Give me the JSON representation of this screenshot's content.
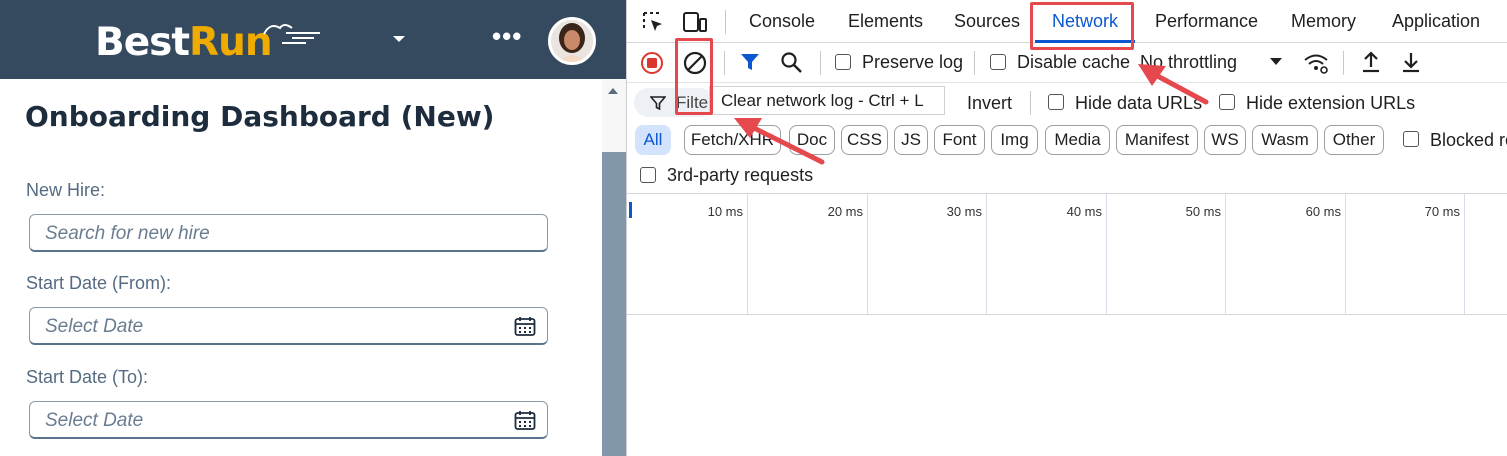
{
  "app": {
    "logo_best": "Best",
    "logo_run": "Run",
    "more_label": "•••",
    "page_title": "Onboarding Dashboard (New)",
    "fields": [
      {
        "label": "New Hire:",
        "placeholder": "Search for new hire"
      },
      {
        "label": "Start Date (From):",
        "placeholder": "Select Date"
      },
      {
        "label": "Start Date (To):",
        "placeholder": "Select Date"
      }
    ],
    "colors": {
      "shell": "#354a5f",
      "accent": "#f0ab00"
    }
  },
  "devtools": {
    "tabs": [
      "Console",
      "Elements",
      "Sources",
      "Network",
      "Performance",
      "Memory",
      "Application"
    ],
    "active_tab": "Network",
    "toolbar": {
      "preserve_log": "Preserve log",
      "disable_cache": "Disable cache",
      "throttling": "No throttling"
    },
    "filter_bar": {
      "filter_placeholder": "Filter",
      "tooltip": "Clear network log - Ctrl + L",
      "invert": "Invert",
      "hide_data_urls": "Hide data URLs",
      "hide_extension_urls": "Hide extension URLs"
    },
    "type_chips": [
      "All",
      "Fetch/XHR",
      "Doc",
      "CSS",
      "JS",
      "Font",
      "Img",
      "Media",
      "Manifest",
      "WS",
      "Wasm",
      "Other"
    ],
    "blocked_label": "Blocked re",
    "third_party": "3rd-party requests",
    "timeline_ticks": [
      "10 ms",
      "20 ms",
      "30 ms",
      "40 ms",
      "50 ms",
      "60 ms",
      "70 ms"
    ]
  }
}
